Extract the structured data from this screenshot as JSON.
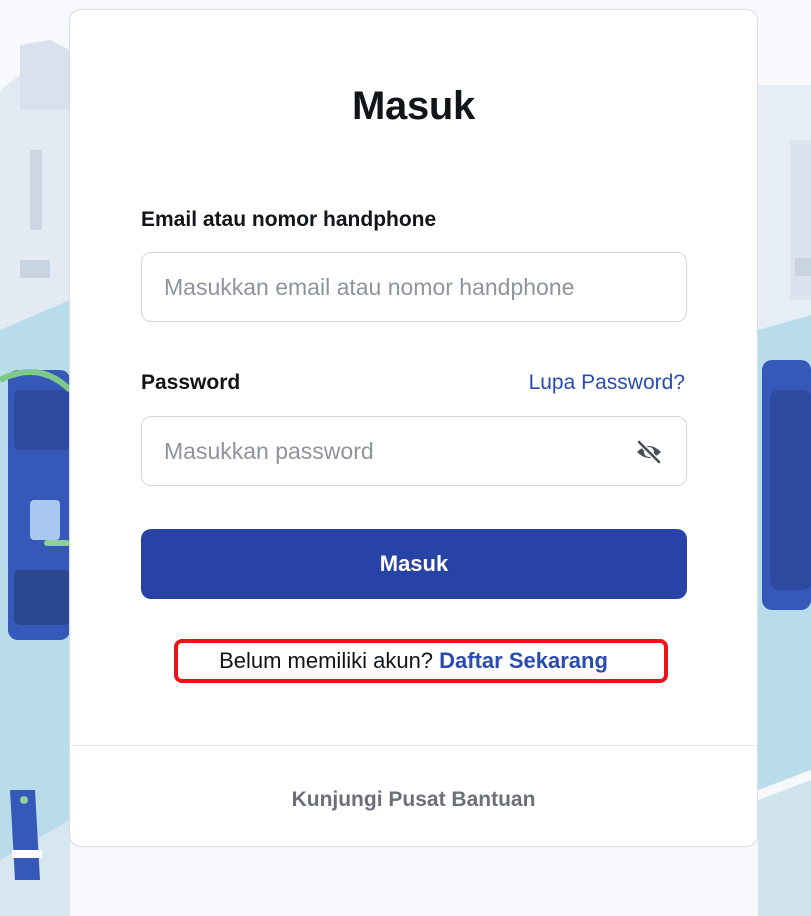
{
  "login": {
    "title": "Masuk",
    "email_label": "Email atau nomor handphone",
    "email_value": "",
    "email_placeholder": "Masukkan email atau nomor handphone",
    "password_label": "Password",
    "forgot_link": "Lupa Password?",
    "password_value": "",
    "password_placeholder": "Masukkan password",
    "password_toggle_icon": "eye-slash-icon",
    "submit_label": "Masuk",
    "signup_prompt": "Belum memiliki akun?",
    "signup_link": "Daftar Sekarang",
    "help_link": "Kunjungi Pusat Bantuan"
  },
  "colors": {
    "primary": "#2743a6",
    "link": "#2a4bb0",
    "highlight": "#e8151b",
    "muted": "#6b7078"
  }
}
